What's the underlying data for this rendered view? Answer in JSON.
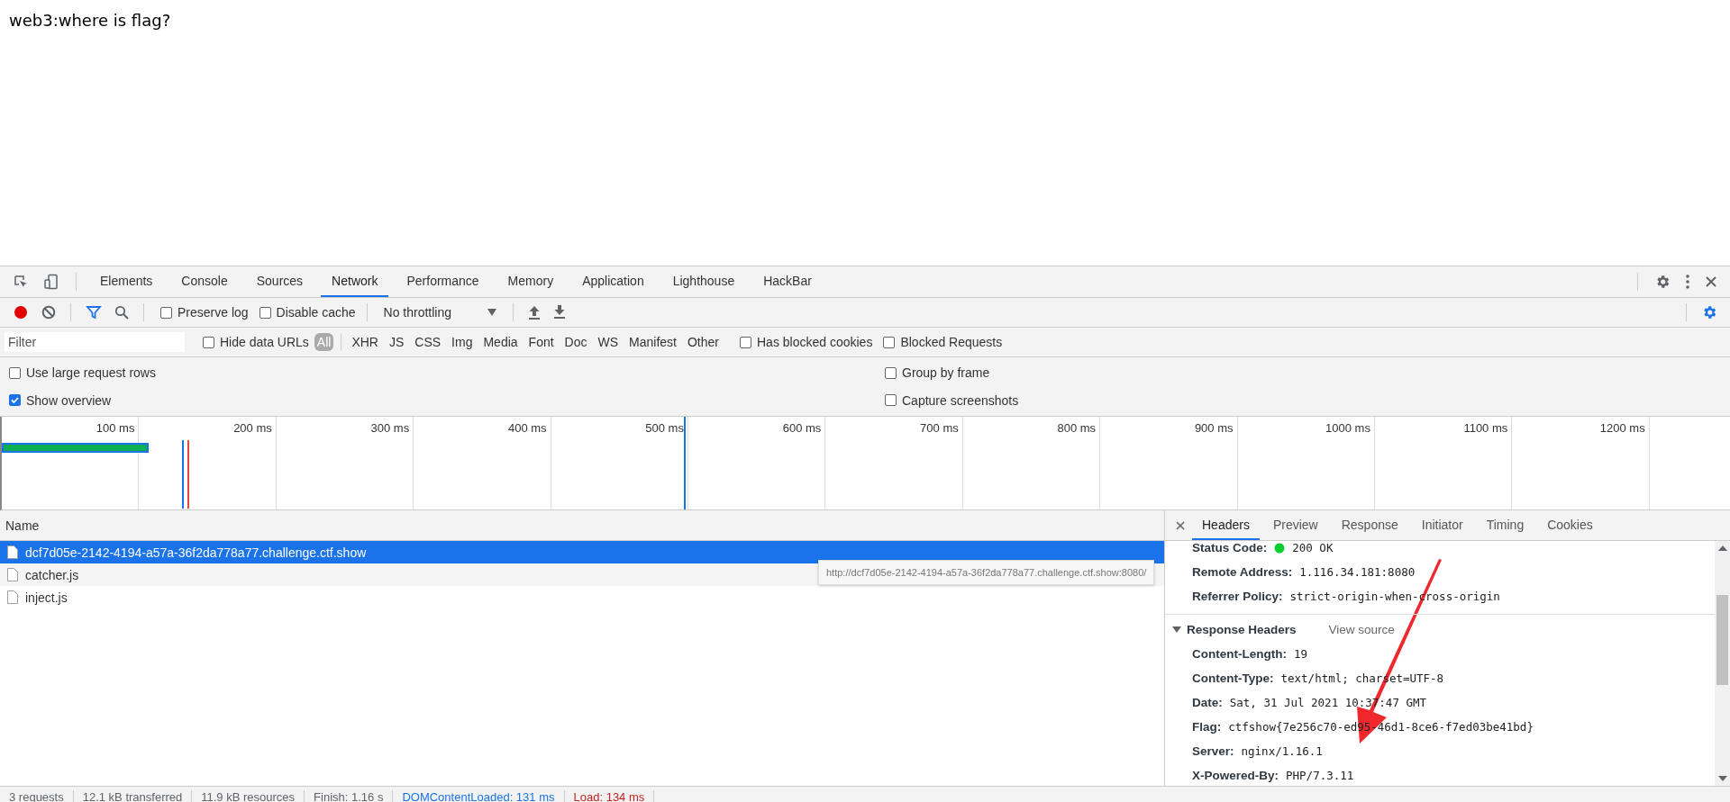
{
  "page": {
    "heading": "web3:where is flag?"
  },
  "devtools": {
    "panel_tabs": [
      {
        "label": "Elements",
        "selected": false
      },
      {
        "label": "Console",
        "selected": false
      },
      {
        "label": "Sources",
        "selected": false
      },
      {
        "label": "Network",
        "selected": true
      },
      {
        "label": "Performance",
        "selected": false
      },
      {
        "label": "Memory",
        "selected": false
      },
      {
        "label": "Application",
        "selected": false
      },
      {
        "label": "Lighthouse",
        "selected": false
      },
      {
        "label": "HackBar",
        "selected": false
      }
    ],
    "toolbar": {
      "recording": true,
      "filter_active": true,
      "checkboxes": [
        {
          "label": "Preserve log",
          "checked": false
        },
        {
          "label": "Disable cache",
          "checked": false
        }
      ],
      "throttling": "No throttling"
    },
    "filter_bar": {
      "placeholder": "Filter",
      "hide_data_urls": {
        "label": "Hide data URLs",
        "checked": false
      },
      "types": [
        {
          "label": "All",
          "selected": true
        },
        {
          "label": "XHR",
          "selected": false
        },
        {
          "label": "JS",
          "selected": false
        },
        {
          "label": "CSS",
          "selected": false
        },
        {
          "label": "Img",
          "selected": false
        },
        {
          "label": "Media",
          "selected": false
        },
        {
          "label": "Font",
          "selected": false
        },
        {
          "label": "Doc",
          "selected": false
        },
        {
          "label": "WS",
          "selected": false
        },
        {
          "label": "Manifest",
          "selected": false
        },
        {
          "label": "Other",
          "selected": false
        }
      ],
      "extra_checkboxes": [
        {
          "label": "Has blocked cookies",
          "checked": false
        },
        {
          "label": "Blocked Requests",
          "checked": false
        }
      ]
    },
    "settings": {
      "left": [
        {
          "label": "Use large request rows",
          "checked": false
        },
        {
          "label": "Show overview",
          "checked": true
        }
      ],
      "right": [
        {
          "label": "Group by frame",
          "checked": false
        },
        {
          "label": "Capture screenshots",
          "checked": false
        }
      ]
    },
    "overview": {
      "ticks": [
        "100 ms",
        "200 ms",
        "300 ms",
        "400 ms",
        "500 ms",
        "600 ms",
        "700 ms",
        "800 ms",
        "900 ms",
        "1000 ms",
        "1100 ms",
        "1200 ms"
      ]
    },
    "requests": {
      "column": "Name",
      "rows": [
        {
          "name": "dcf7d05e-2142-4194-a57a-36f2da778a77.challenge.ctf.show",
          "selected": true
        },
        {
          "name": "catcher.js",
          "selected": false
        },
        {
          "name": "inject.js",
          "selected": false
        }
      ],
      "tooltip": "http://dcf7d05e-2142-4194-a57a-36f2da778a77.challenge.ctf.show:8080/"
    },
    "details": {
      "tabs": [
        {
          "label": "Headers",
          "selected": true
        },
        {
          "label": "Preview",
          "selected": false
        },
        {
          "label": "Response",
          "selected": false
        },
        {
          "label": "Initiator",
          "selected": false
        },
        {
          "label": "Timing",
          "selected": false
        },
        {
          "label": "Cookies",
          "selected": false
        }
      ],
      "general": [
        {
          "name": "Status Code:",
          "value": "200 OK",
          "kind": "status"
        },
        {
          "name": "Remote Address:",
          "value": "1.116.34.181:8080",
          "kind": "plain"
        },
        {
          "name": "Referrer Policy:",
          "value": "strict-origin-when-cross-origin",
          "kind": "plain"
        }
      ],
      "response_headers": {
        "title": "Response Headers",
        "expanded": true,
        "link": "View source",
        "items": [
          {
            "name": "Content-Length:",
            "value": "19"
          },
          {
            "name": "Content-Type:",
            "value": "text/html; charset=UTF-8"
          },
          {
            "name": "Date:",
            "value": "Sat, 31 Jul 2021 10:37:47 GMT"
          },
          {
            "name": "Flag:",
            "value": "ctfshow{7e256c70-ed95-46d1-8ce6-f7ed03be41bd}"
          },
          {
            "name": "Server:",
            "value": "nginx/1.16.1"
          },
          {
            "name": "X-Powered-By:",
            "value": "PHP/7.3.11"
          }
        ]
      }
    },
    "status_bar": [
      {
        "text": "3 requests",
        "kind": "plain"
      },
      {
        "text": "12.1 kB transferred",
        "kind": "plain"
      },
      {
        "text": "11.9 kB resources",
        "kind": "plain"
      },
      {
        "text": "Finish: 1.16 s",
        "kind": "plain"
      },
      {
        "text": "DOMContentLoaded: 131 ms",
        "kind": "dom"
      },
      {
        "text": "Load: 134 ms",
        "kind": "load"
      }
    ]
  }
}
